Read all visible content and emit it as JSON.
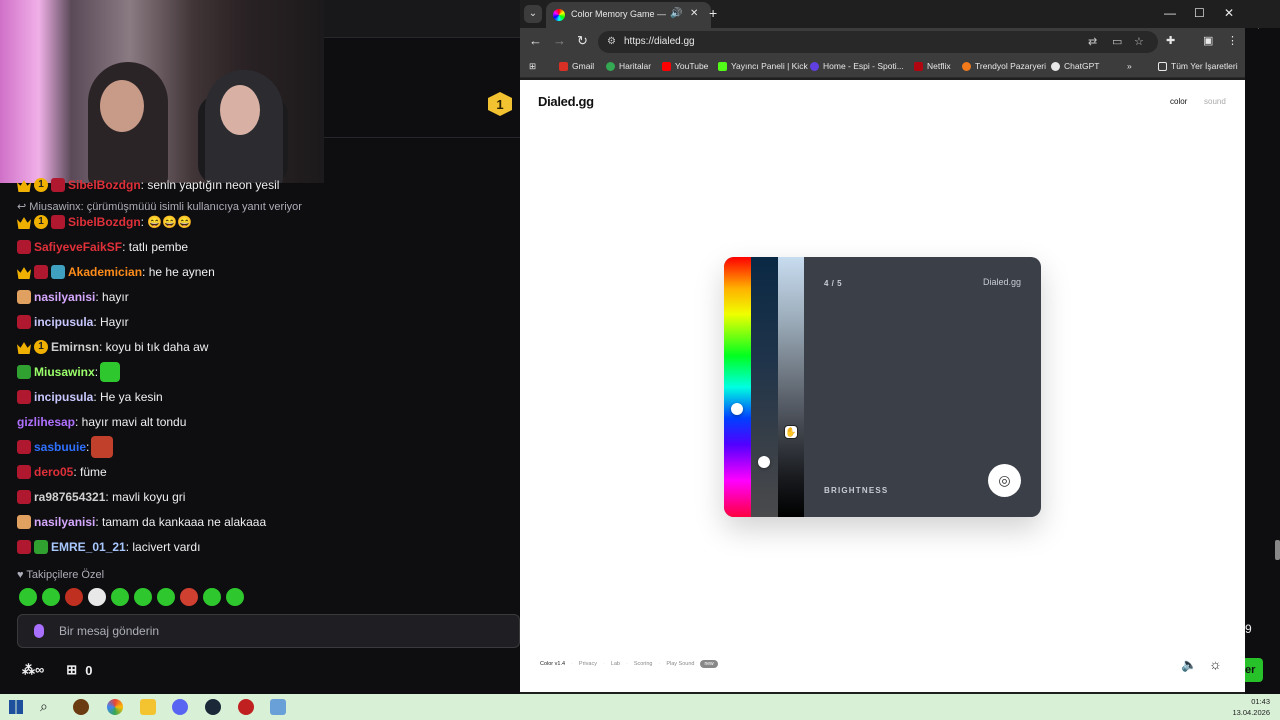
{
  "chat": {
    "reply_note": "Miusawinx: çürümüşmüüü isimli kullanıcıya yanıt veriyor",
    "messages": [
      {
        "user": "SibelBozdgn",
        "color": "#e0303a",
        "text": ": senin yaptığın neon yesil",
        "top": 0
      },
      {
        "user": "SibelBozdgn",
        "color": "#e0303a",
        "text": ": 😄😄😄"
      },
      {
        "user": "SafiyeveFaikSF",
        "color": "#e0303a",
        "text": ": tatlı pembe"
      },
      {
        "user": "Akademician",
        "color": "#ff8c1a",
        "text": ": he he aynen"
      },
      {
        "user": "nasilyanisi",
        "color": "#d6a8ff",
        "text": ": hayır"
      },
      {
        "user": "incipusula",
        "color": "#c8c8ff",
        "text": ": Hayır"
      },
      {
        "user": "Emirnsn",
        "color": "#d0d0d0",
        "text": ": koyu bi tık daha aw"
      },
      {
        "user": "Miusawinx",
        "color": "#9aff6a",
        "text": ":"
      },
      {
        "user": "incipusula",
        "color": "#c8c8ff",
        "text": ": He ya kesin"
      },
      {
        "user": "gizlihesap",
        "color": "#b070ff",
        "text": ": hayır mavi alt tondu"
      },
      {
        "user": "sasbuuie",
        "color": "#3070ff",
        "text": ":"
      },
      {
        "user": "dero05",
        "color": "#e0303a",
        "text": ": füme"
      },
      {
        "user": "ra987654321",
        "color": "#d0d0d0",
        "text": ": mavli koyu gri"
      },
      {
        "user": "nasilyanisi",
        "color": "#d6a8ff",
        "text": ": tamam da kankaaa ne alakaaa"
      },
      {
        "user": "EMRE_01_21",
        "color": "#a8c8ff",
        "text": ": lacivert vardı"
      }
    ],
    "followers_only": "Takipçilere Özel",
    "input_placeholder": "Bir mesaj gönderin",
    "footer_count": "0"
  },
  "browser": {
    "tab_title": "Color Memory Game — Ho",
    "url": "https://dialed.gg",
    "bookmarks": [
      "Gmail",
      "Haritalar",
      "YouTube",
      "Yayıncı Paneli | Kick",
      "Home - Espi - Spoti...",
      "Netflix",
      "Trendyol Pazaryeri",
      "ChatGPT"
    ],
    "bookmarks_all": "Tüm Yer İşaretleri"
  },
  "page": {
    "logo": "Dialed.gg",
    "nav_color": "color",
    "nav_sound": "sound",
    "round": "4 / 5",
    "card_brand": "Dialed.gg",
    "mode_label": "BRIGHTNESS",
    "footer_version": "Color v1.4",
    "footer_links": [
      "Privacy",
      "Lab",
      "Scoring",
      "Play Sound"
    ],
    "footer_badge": "new"
  },
  "taskbar": {
    "time": "01:43",
    "date": "13.04.2026"
  },
  "colors": {
    "twitch_bg": "#0e0e10",
    "card_bg": "#3b3f48",
    "taskbar_bg": "#d8f0d6"
  }
}
